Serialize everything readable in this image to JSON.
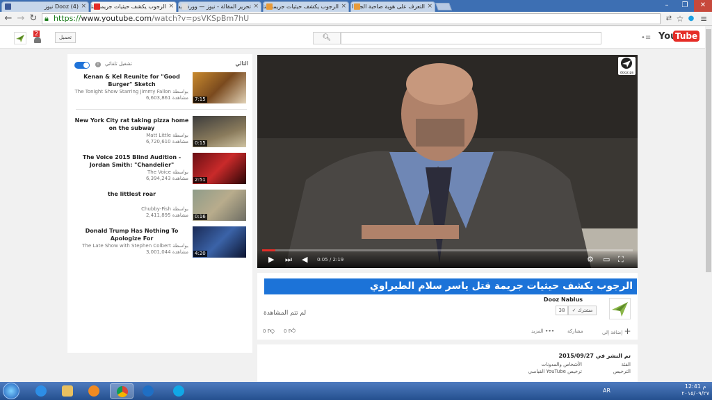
{
  "browser": {
    "tabs": [
      {
        "label": "(4) Dooz نيوز",
        "active": false
      },
      {
        "label": "الرجوب يكشف حيثيات جريمة قتل",
        "active": true
      },
      {
        "label": "تحرير المقالة - نيوز — ووردبريس",
        "active": false
      },
      {
        "label": "الرجوب يكشف حيثيات جريمة قتل",
        "active": false
      },
      {
        "label": "التعرف على هوية صاحبة الجثة ا",
        "active": false
      }
    ],
    "url_prefix": "https://",
    "url_host": "www.youtube.com",
    "url_path": "/watch?v=psVKSpBm7hU"
  },
  "header": {
    "logo_you": "You",
    "logo_tube": "Tube",
    "upload_label": "تحميل",
    "notification_count": "2",
    "search_placeholder": ""
  },
  "sidebar": {
    "up_next_label": "التالي",
    "autoplay_label": "تشغيل تلقائي",
    "videos": [
      {
        "title": "Kenan & Kel Reunite for \"Good Burger\" Sketch",
        "channel": "The Tonight Show Starring Jimmy Fallon بواسطة",
        "views": "6,603,861 مشاهدة",
        "duration": "7:15"
      },
      {
        "title": "New York City rat taking pizza home on the subway",
        "channel": "Matt Little بواسطة",
        "views": "6,720,610 مشاهدة",
        "duration": "0:15"
      },
      {
        "title": "The Voice 2015 Blind Audition - Jordan Smith: \"Chandelier\"",
        "channel": "The Voice بواسطة",
        "views": "6,394,243 مشاهدة",
        "duration": "2:51"
      },
      {
        "title": "the littlest roar",
        "channel": "Chubby-Fish بواسطة",
        "views": "2,411,895 مشاهدة",
        "duration": "0:16"
      },
      {
        "title": "Donald Trump Has Nothing To Apologize For",
        "channel": "The Late Show with Stephen Colbert بواسطة",
        "views": "3,001,044 مشاهدة",
        "duration": "4:20"
      }
    ]
  },
  "player": {
    "watermark": "dooz.ps",
    "current_time": "0:05 / 2:19",
    "progress": 0.036
  },
  "info": {
    "title": "الرجوب يكشف حيثيات جريمة قتل ياسر سلام الطيراوي",
    "channel_name": "Dooz Nablus",
    "subscribe_label": "مشترك",
    "subscriber_count": "38",
    "not_watched": "لم تتم المشاهدة",
    "likes": "0",
    "dislikes": "0",
    "add_to_label": "إضافة إلى",
    "share_label": "مشاركة",
    "more_label": "المزيد"
  },
  "description": {
    "published_label": "تم النشر في 2015/09/27",
    "category_label": "الفئة",
    "category_value": "الأشخاص والمدونات",
    "license_label": "الترخيص",
    "license_value": "ترخيص YouTube القياسي"
  },
  "taskbar": {
    "lang": "AR",
    "time": "12:41 م",
    "date": "٢٠١٥/٠٩/٢٧"
  },
  "colors": {
    "accent_blue": "#1c73d8",
    "youtube_red": "#e52d27",
    "taskbar": "#25508f"
  }
}
